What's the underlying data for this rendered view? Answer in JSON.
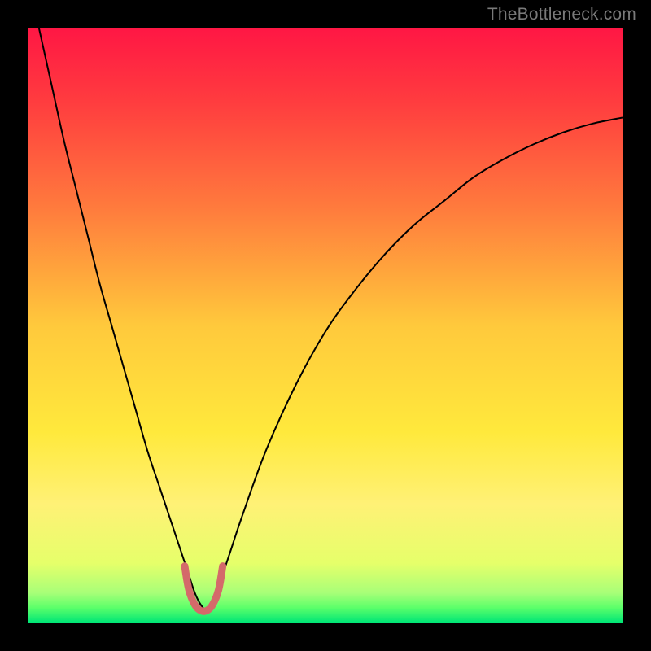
{
  "watermark": "TheBottleneck.com",
  "chart_data": {
    "type": "line",
    "title": "",
    "xlabel": "",
    "ylabel": "",
    "xlim": [
      0,
      100
    ],
    "ylim": [
      0,
      100
    ],
    "grid": false,
    "legend": false,
    "gradient_stops": [
      {
        "offset": 0,
        "color": "#ff1744"
      },
      {
        "offset": 0.12,
        "color": "#ff3b3f"
      },
      {
        "offset": 0.3,
        "color": "#ff7a3d"
      },
      {
        "offset": 0.5,
        "color": "#ffc93c"
      },
      {
        "offset": 0.68,
        "color": "#ffe93c"
      },
      {
        "offset": 0.8,
        "color": "#fff176"
      },
      {
        "offset": 0.9,
        "color": "#e6ff6a"
      },
      {
        "offset": 0.95,
        "color": "#a8ff78"
      },
      {
        "offset": 0.975,
        "color": "#5cff6a"
      },
      {
        "offset": 1.0,
        "color": "#00e676"
      }
    ],
    "series": [
      {
        "name": "bottleneck-curve",
        "color": "#000000",
        "width": 2,
        "x": [
          0,
          2,
          4,
          6,
          8,
          10,
          12,
          14,
          16,
          18,
          20,
          22,
          24,
          26,
          27,
          28,
          29,
          30,
          31,
          32,
          34,
          36,
          40,
          45,
          50,
          55,
          60,
          65,
          70,
          75,
          80,
          85,
          90,
          95,
          100
        ],
        "y": [
          108,
          99,
          90,
          81,
          73,
          65,
          57,
          50,
          43,
          36,
          29,
          23,
          17,
          11,
          8,
          5,
          3,
          2,
          3,
          6,
          12,
          18,
          29,
          40,
          49,
          56,
          62,
          67,
          71,
          75,
          78,
          80.5,
          82.5,
          84,
          85
        ]
      },
      {
        "name": "optimal-zone",
        "color": "#d46a6a",
        "width": 9,
        "linecap": "round",
        "x": [
          26.3,
          27,
          28,
          29,
          30,
          31,
          32,
          32.7
        ],
        "y": [
          9.5,
          5.5,
          3,
          2,
          2,
          3,
          5.5,
          9.5
        ]
      }
    ],
    "annotations": []
  }
}
